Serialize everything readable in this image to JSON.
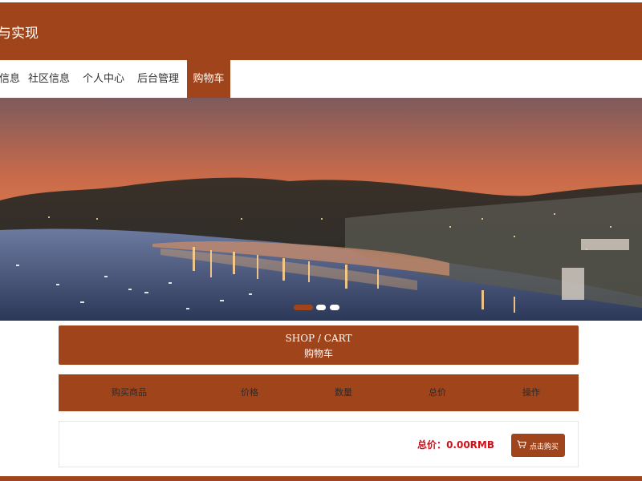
{
  "header": {
    "site_title": "与实现"
  },
  "nav": {
    "items": [
      {
        "label": "信息",
        "active": false
      },
      {
        "label": "社区信息",
        "active": false
      },
      {
        "label": "个人中心",
        "active": false
      },
      {
        "label": "后台管理",
        "active": false
      },
      {
        "label": "购物车",
        "active": true
      }
    ]
  },
  "banner": {
    "slides": 3,
    "active_slide": 1
  },
  "cart": {
    "heading_en": "SHOP / CART",
    "heading_zh": "购物车",
    "columns": [
      "购买商品",
      "价格",
      "数量",
      "总价",
      "操作"
    ],
    "rows": [],
    "total_label": "总价：",
    "total_value": "0.00RMB",
    "buy_button_label": "点击购买",
    "buy_icon": "shopping-cart-icon"
  },
  "colors": {
    "brand": "#a0441c",
    "total_text": "#d0101a",
    "background": "#ffffff"
  }
}
